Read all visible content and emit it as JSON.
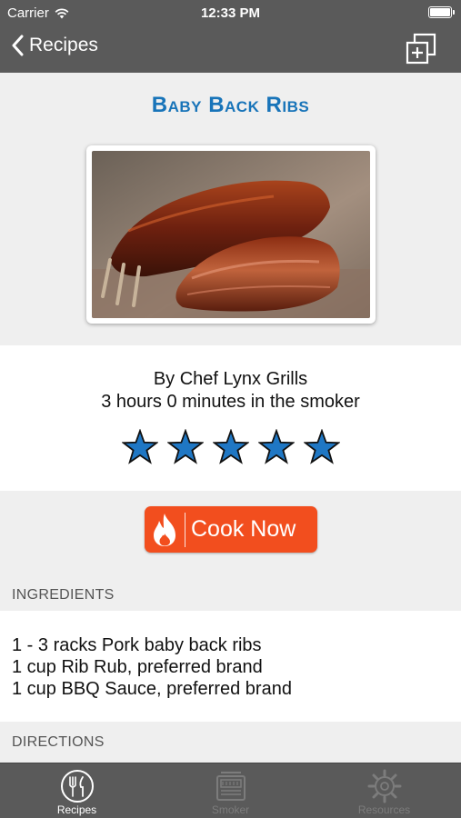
{
  "status_bar": {
    "carrier": "Carrier",
    "time": "12:33 PM"
  },
  "nav": {
    "back_label": "Recipes",
    "add_icon": "add-copy-icon"
  },
  "recipe": {
    "title": "Baby Back Ribs",
    "chef": "By Chef Lynx Grills",
    "smoke_time": "3 hours 0 minutes in the smoker",
    "rating": 5,
    "rating_max": 5
  },
  "cook_button": {
    "label": "Cook Now"
  },
  "ingredients": {
    "header": "INGREDIENTS",
    "items": [
      "1 - 3 racks Pork baby back ribs",
      "1 cup Rib Rub, preferred brand",
      "1 cup BBQ Sauce, preferred brand"
    ]
  },
  "directions": {
    "header": "DIRECTIONS"
  },
  "tabs": [
    {
      "label": "Recipes",
      "icon": "fork-knife-icon",
      "active": true
    },
    {
      "label": "Smoker",
      "icon": "smoker-icon",
      "active": false
    },
    {
      "label": "Resources",
      "icon": "gear-icon",
      "active": false
    }
  ],
  "colors": {
    "bar": "#5a5a5a",
    "title": "#1874b9",
    "star": "#1f77c4",
    "cook_button": "#f24e1e",
    "section_bg": "#efefef"
  }
}
